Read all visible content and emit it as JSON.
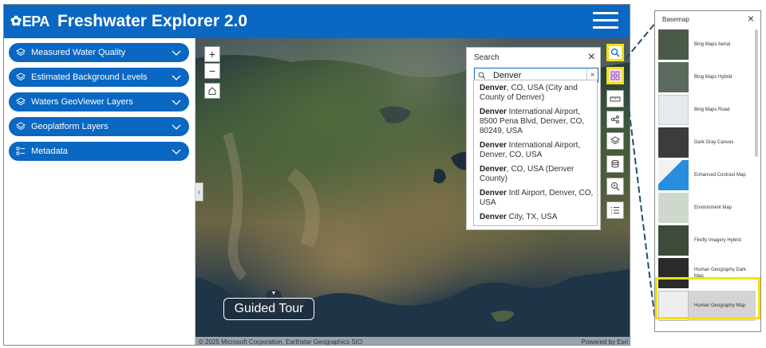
{
  "header": {
    "logo": "EPA",
    "title": "Freshwater Explorer 2.0"
  },
  "sidebar": {
    "items": [
      {
        "label": "Measured Water Quality",
        "icon": "layers-icon"
      },
      {
        "label": "Estimated Background Levels",
        "icon": "layers-icon"
      },
      {
        "label": "Waters GeoViewer Layers",
        "icon": "layers-icon"
      },
      {
        "label": "Geoplatform Layers",
        "icon": "layers-icon"
      },
      {
        "label": "Metadata",
        "icon": "list-icon"
      }
    ]
  },
  "map": {
    "zoom_in": "+",
    "zoom_out": "−",
    "attribution": "© 2025 Microsoft Corporation, Earthstar Geographics SIO",
    "powered": "Powered by Esri",
    "guided_tour": "Guided Tour",
    "tools": [
      "search-icon",
      "basemap-gallery-icon",
      "measure-icon",
      "share-icon",
      "layer-list-icon",
      "database-icon",
      "zoom-search-icon",
      "legend-list-icon"
    ]
  },
  "search": {
    "title": "Search",
    "value": "Denver",
    "clear": "×",
    "results": [
      {
        "match": "Denver",
        "rest": ", CO, USA (City and County of Denver)"
      },
      {
        "match": "Denver",
        "rest": " International Airport, 8500 Pena Blvd, Denver, CO, 80249, USA"
      },
      {
        "match": "Denver",
        "rest": " International Airport, Denver, CO, USA"
      },
      {
        "match": "Denver",
        "rest": ", CO, USA (Denver County)"
      },
      {
        "match": "Denver",
        "rest": " Intl Airport, Denver, CO, USA"
      },
      {
        "match": "Denver",
        "rest": " City, TX, USA"
      }
    ]
  },
  "basemap": {
    "title": "Basemap",
    "items": [
      {
        "label": "Bing Maps Aerial",
        "color": "#4a5a48"
      },
      {
        "label": "Bing Maps Hybrid",
        "color": "#5b6a5c"
      },
      {
        "label": "Bing Maps Road",
        "color": "#e6e9ee"
      },
      {
        "label": "Dark Gray Canvas",
        "color": "#3c3c3c"
      },
      {
        "label": "Enhanced Contrast Map",
        "color": "#7ab7e8"
      },
      {
        "label": "Environment Map",
        "color": "#cfd8cc"
      },
      {
        "label": "Firefly Imagery Hybrid",
        "color": "#3e4a3a"
      },
      {
        "label": "Human Geography Dark Map",
        "color": "#2a2a2a"
      },
      {
        "label": "Human Geography Map",
        "color": "#eeeeee"
      }
    ]
  },
  "colors": {
    "brand": "#0a67c2",
    "highlight": "#f4e10c"
  }
}
